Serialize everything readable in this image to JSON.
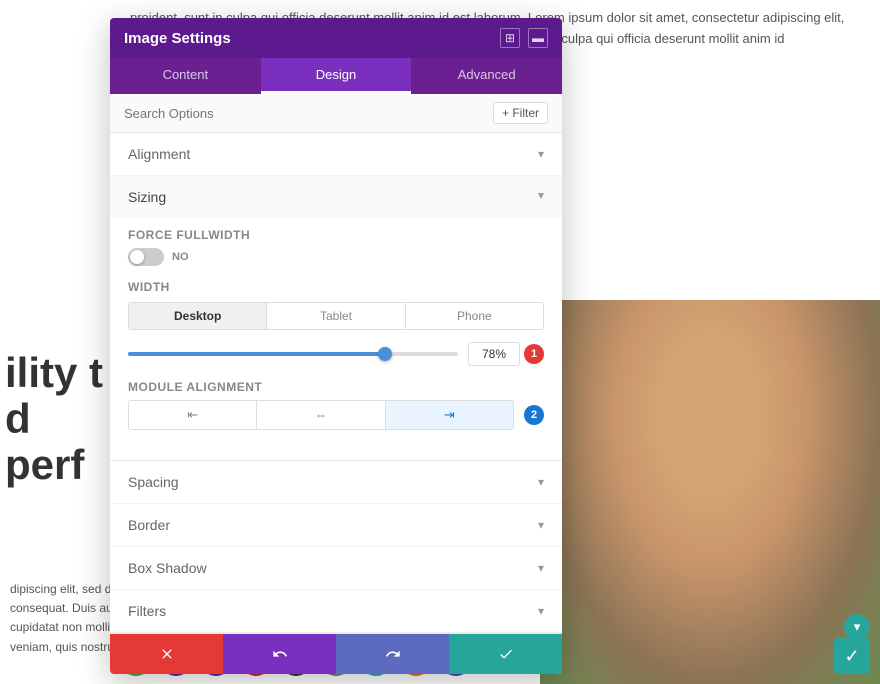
{
  "background": {
    "top_text": "proident, sunt in culpa qui officia deserunt mollit anim id est laborum. Lorem ipsum dolor sit amet, consectetur adipiscing elit, veniam, quis nostrud exercitation rehenderit in voluptate velit esse cillum n culpa qui officia deserunt mollit anim id",
    "left_text": "bility t d perf",
    "bottom_text": "dipiscing elit, sed do eiusmod exercitation ullamco laboris nisi ut aliquip ex ea commodo consequat. Duis aute irure velit esse cillum dolore eu fugiat nulla pariatur. Excepteur sint cupidatat non mollit anim id est laborum olor labore et dolore magna aliqua. Ut enim ad minim veniam, quis nostrud exercitation"
  },
  "modal": {
    "title": "Image Settings",
    "header_icon1": "⊞",
    "header_icon2": "⊡",
    "tabs": [
      {
        "label": "Content",
        "active": false
      },
      {
        "label": "Design",
        "active": true
      },
      {
        "label": "Advanced",
        "active": false
      }
    ],
    "search_placeholder": "Search Options",
    "filter_label": "+ Filter",
    "sections": {
      "alignment": {
        "label": "Alignment",
        "expanded": false
      },
      "sizing": {
        "label": "Sizing",
        "expanded": true,
        "force_fullwidth": {
          "label": "Force Fullwidth",
          "value": "NO"
        },
        "width": {
          "label": "Width",
          "device_tabs": [
            "Desktop",
            "Tablet",
            "Phone"
          ],
          "active_device": "Desktop",
          "value": "78%",
          "badge": "1",
          "slider_percent": 78
        },
        "module_alignment": {
          "label": "Module Alignment",
          "options": [
            "left",
            "center",
            "right"
          ],
          "active": "right",
          "badge": "2"
        }
      },
      "spacing": {
        "label": "Spacing",
        "expanded": false
      },
      "border": {
        "label": "Border",
        "expanded": false
      },
      "box_shadow": {
        "label": "Box Shadow",
        "expanded": false
      },
      "filters": {
        "label": "Filters",
        "expanded": false
      }
    }
  },
  "modal_actions": [
    {
      "icon": "✕",
      "color": "red",
      "name": "cancel"
    },
    {
      "icon": "↩",
      "color": "purple",
      "name": "undo"
    },
    {
      "icon": "↻",
      "color": "indigo",
      "name": "redo"
    },
    {
      "icon": "✓",
      "color": "teal",
      "name": "save"
    }
  ],
  "floating_fabs": [
    {
      "icon": "+",
      "color": "green",
      "name": "add"
    },
    {
      "icon": "⏻",
      "color": "purple-dark",
      "name": "power"
    },
    {
      "icon": "🎨",
      "color": "purple-dark",
      "name": "style"
    },
    {
      "icon": "🗑",
      "color": "red-dark",
      "name": "delete"
    },
    {
      "icon": "✕",
      "color": "dark",
      "name": "close"
    },
    {
      "icon": "⚙",
      "color": "gray",
      "name": "settings"
    },
    {
      "icon": "◎",
      "color": "teal",
      "name": "target"
    },
    {
      "icon": "⏸",
      "color": "orange",
      "name": "pause"
    },
    {
      "icon": "≡",
      "color": "indigo",
      "name": "menu"
    }
  ],
  "icons": {
    "chevron_down": "▾",
    "chevron_up": "▴",
    "check": "✓",
    "left_align": "⇤",
    "center_align": "⇔",
    "right_align": "⇥",
    "scroll_down": "▾"
  }
}
